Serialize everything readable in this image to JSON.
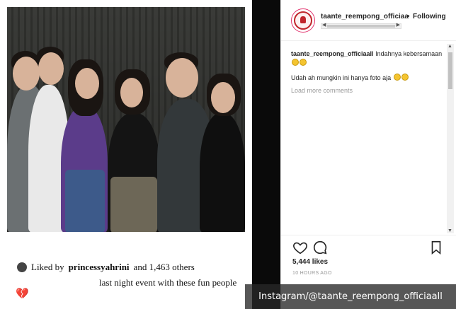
{
  "post_card": {
    "liked_prefix": "Liked by",
    "liked_user": "princessyahrini",
    "liked_suffix": "and 1,463 others",
    "caption": "last night event with these fun people",
    "heart_icon": "broken-heart-icon"
  },
  "panel": {
    "header": {
      "username": "taante_reempong_officiaa",
      "separator": "•",
      "follow_status": "Following"
    },
    "comments": [
      {
        "username": "taante_reempong_officiaall",
        "text": "Indahnya kebersamaan",
        "emojis": [
          "grin-emoji",
          "grin-emoji"
        ]
      },
      {
        "text": "Udah ah mungkin ini hanya foto aja",
        "emojis": [
          "grin-emoji",
          "grin-emoji"
        ]
      }
    ],
    "load_more": "Load more comments",
    "likes": "5,444 likes",
    "time": "10 HOURS AGO",
    "colors": {
      "avatar_ring": "#c0262c",
      "text": "#262626",
      "muted": "#999999"
    }
  },
  "watermark": "Instagram/@taante_reempong_officiaall"
}
